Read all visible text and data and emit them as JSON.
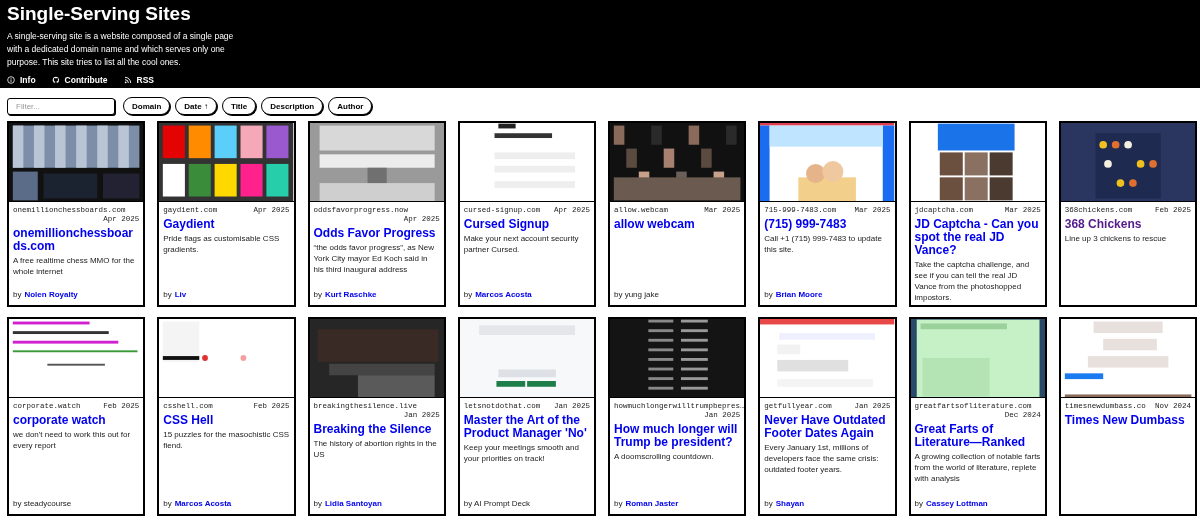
{
  "header": {
    "title": "Single-Serving Sites",
    "description": "A single-serving site is a website composed of a single page with a dedicated domain name and which serves only one purpose. This site tries to list all the cool ones.",
    "links": [
      {
        "kind": "info",
        "label": "Info"
      },
      {
        "kind": "github",
        "label": "Contribute"
      },
      {
        "kind": "rss",
        "label": "RSS"
      }
    ]
  },
  "filter": {
    "placeholder": "Filter..."
  },
  "sort_buttons": [
    {
      "label": "Domain"
    },
    {
      "label": "Date",
      "indicator": "↑"
    },
    {
      "label": "Title"
    },
    {
      "label": "Description"
    },
    {
      "label": "Author"
    }
  ],
  "cards": [
    {
      "domain": "onemillionchessboards.com",
      "date": "Apr 2025",
      "title": "onemillionchessboards.com",
      "visited": false,
      "description": "A free realtime chess MMO for the whole internet",
      "by": "by",
      "author": "Nolen Royalty",
      "author_linked": true
    },
    {
      "domain": "gaydient.com",
      "date": "Apr 2025",
      "title": "Gaydient",
      "visited": false,
      "description": "Pride flags as customisable CSS gradients.",
      "by": "by",
      "author": "Liv",
      "author_linked": true
    },
    {
      "domain": "oddsfavorprogress.now",
      "date": "Apr 2025",
      "title": "Odds Favor Progress",
      "visited": false,
      "description": "“the odds favor progress”, as New York City mayor Ed Koch said in his third inaugural address",
      "by": "by",
      "author": "Kurt Raschke",
      "author_linked": true
    },
    {
      "domain": "cursed-signup.com",
      "date": "Apr 2025",
      "title": "Cursed Signup",
      "visited": false,
      "description": "Make your next account security partner Cursed.",
      "by": "by",
      "author": "Marcos Acosta",
      "author_linked": true
    },
    {
      "domain": "allow.webcam",
      "date": "Mar 2025",
      "title": "allow webcam",
      "visited": false,
      "by": "by yung jake",
      "author_linked": false
    },
    {
      "domain": "715-999-7483.com",
      "date": "Mar 2025",
      "title": "(715) 999-7483",
      "visited": false,
      "description": "Call +1 (715) 999-7483 to update this site.",
      "by": "by",
      "author": "Brian Moore",
      "author_linked": true
    },
    {
      "domain": "jdcaptcha.com",
      "date": "Mar 2025",
      "title": "JD Captcha - Can you spot the real JD Vance?",
      "visited": false,
      "description": "Take the captcha challenge, and see if you can tell the real JD Vance from the photoshopped impostors."
    },
    {
      "domain": "368chickens.com",
      "date": "Feb 2025",
      "title": "368 Chickens",
      "visited": true,
      "description": "Line up 3 chickens to rescue"
    },
    {
      "domain": "corporate.watch",
      "date": "Feb 2025",
      "title": "corporate watch",
      "visited": false,
      "description": "we don't need to work this out for every report",
      "by": "by steadycourse",
      "author_linked": false
    },
    {
      "domain": "csshell.com",
      "date": "Feb 2025",
      "title": "CSS Hell",
      "visited": false,
      "description": "15 puzzles for the masochistic CSS fiend.",
      "by": "by",
      "author": "Marcos Acosta",
      "author_linked": true
    },
    {
      "domain": "breakingthesilence.live",
      "date": "Jan 2025",
      "title": "Breaking the Silence",
      "visited": false,
      "description": "The history of abortion rights in the US",
      "by": "by",
      "author": "Lidia Santoyan",
      "author_linked": true
    },
    {
      "domain": "letsnotdothat.com",
      "date": "Jan 2025",
      "title": "Master the Art of the Product Manager 'No'",
      "visited": false,
      "description": "Keep your meetings smooth and your priorities on track!",
      "by": "by AI Prompt Deck",
      "author_linked": false
    },
    {
      "domain": "howmuchlongerwilltrumpbepres…",
      "date": "Jan 2025",
      "title": "How much longer will Trump be president?",
      "visited": false,
      "description": "A doomscrolling countdown.",
      "by": "by",
      "author": "Roman Jaster",
      "author_linked": true
    },
    {
      "domain": "getfullyear.com",
      "date": "Jan 2025",
      "title": "Never Have Outdated Footer Dates Again",
      "visited": false,
      "description": "Every January 1st, millions of developers face the same crisis: outdated footer years.",
      "by": "by",
      "author": "Shayan",
      "author_linked": true
    },
    {
      "domain": "greatfartsofliterature.com",
      "date": "Dec 2024",
      "title": "Great Farts of Literature—Ranked",
      "visited": false,
      "description": "A growing collection of notable farts from the world of literature, replete with analysis",
      "by": "by",
      "author": "Cassey Lottman",
      "author_linked": true
    },
    {
      "domain": "timesnewdumbass.co",
      "date": "Nov 2024",
      "title": "Times New Dumbass",
      "visited": false
    }
  ]
}
